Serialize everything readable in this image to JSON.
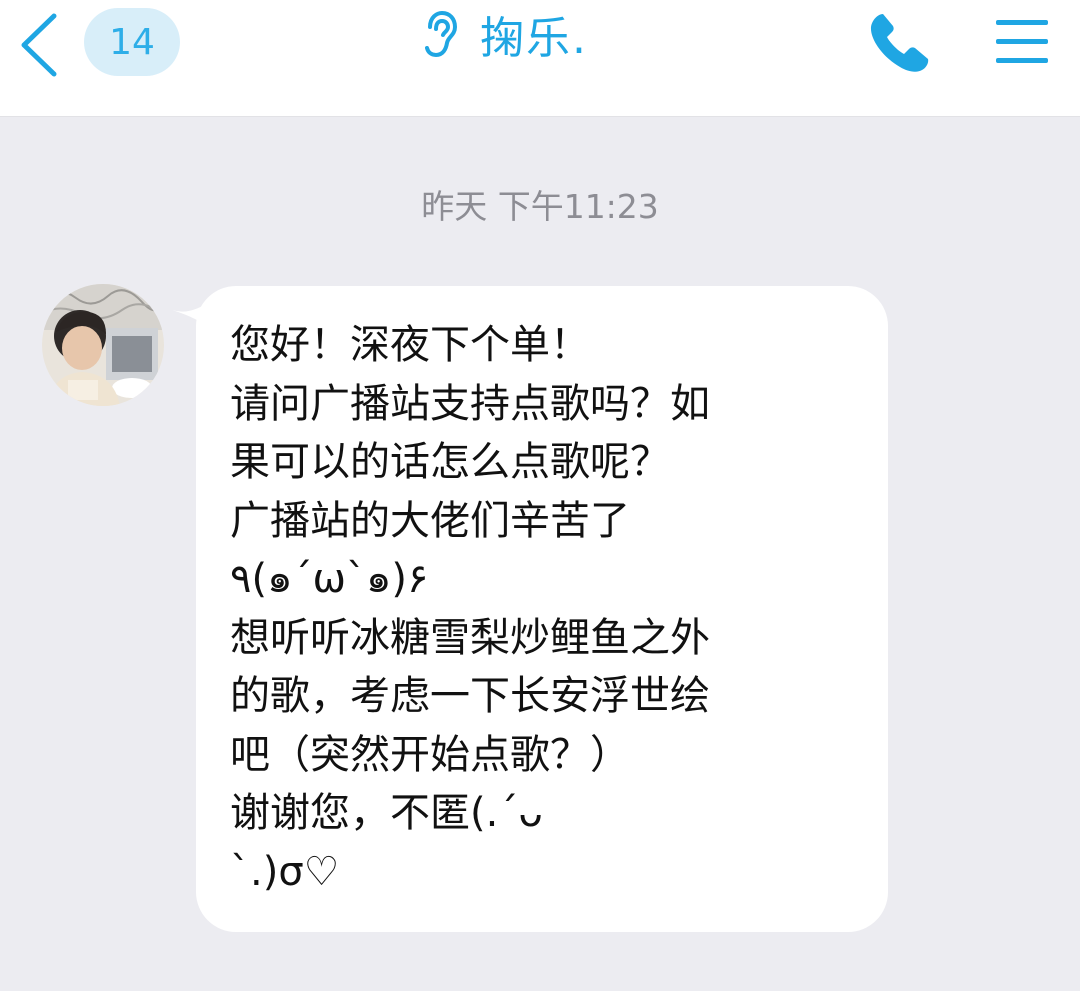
{
  "header": {
    "unread_count": "14",
    "title": "掬乐.",
    "icons": {
      "back": "chevron-left-icon",
      "hearing": "ear-icon",
      "call": "phone-icon",
      "menu": "menu-icon"
    }
  },
  "conversation": {
    "timestamp": "昨天 下午11:23",
    "messages": [
      {
        "sender": "other",
        "avatar": "avatar-photo",
        "text": "您好！深夜下个单！\n请问广播站支持点歌吗？如\n果可以的话怎么点歌呢？\n广播站的大佬们辛苦了\n٩(๑´ω`๑)۶\n想听听冰糖雪梨炒鲤鱼之外\n的歌，考虑一下长安浮世绘\n吧（突然开始点歌？）\n谢谢您，不匿(.´ᴗ\n`.)σ♡"
      }
    ]
  },
  "colors": {
    "accent": "#1fa6e3",
    "badge_bg": "#d8eef9",
    "chat_bg": "#ececf1",
    "bubble_bg": "#ffffff",
    "timestamp": "#8d8d94"
  }
}
